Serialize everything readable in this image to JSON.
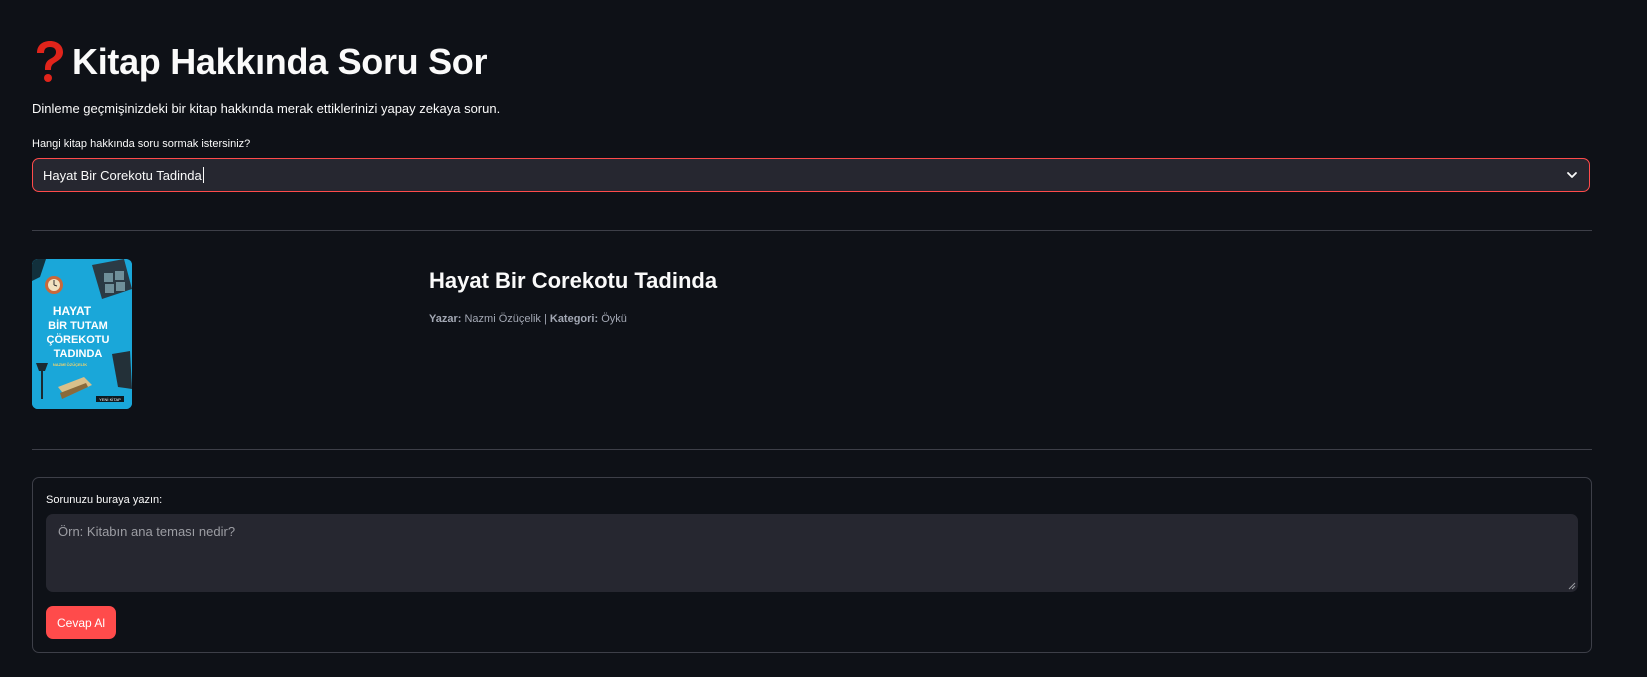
{
  "header": {
    "icon": "question-mark-icon",
    "title": "Kitap Hakkında Soru Sor",
    "subtitle": "Dinleme geçmişinizdeki bir kitap hakkında merak ettiklerinizi yapay zekaya sorun."
  },
  "book_select": {
    "label": "Hangi kitap hakkında soru sormak istersiniz?",
    "selected": "Hayat Bir Corekotu Tadinda",
    "icon": "chevron-down-icon"
  },
  "book": {
    "title": "Hayat Bir Corekotu Tadinda",
    "author_label": "Yazar:",
    "author": "Nazmi Özüçelik",
    "separator": "|",
    "category_label": "Kategori:",
    "category": "Öykü",
    "cover_text": [
      "HAYAT",
      "BİR TUTAM",
      "ÇÖREKOTU",
      "TADINDA"
    ],
    "cover_author": "NAZMİ ÖZÜÇELİK",
    "cover_publisher": "YENİ KİTAP"
  },
  "question_form": {
    "label": "Sorunuzu buraya yazın:",
    "placeholder": "Örn: Kitabın ana teması nedir?",
    "value": "",
    "submit_label": "Cevap Al"
  },
  "colors": {
    "background": "#0e1117",
    "accent": "#ff4b4b",
    "input_background": "#262730",
    "divider": "#3d3f48",
    "cover_background": "#1aa7d9"
  }
}
